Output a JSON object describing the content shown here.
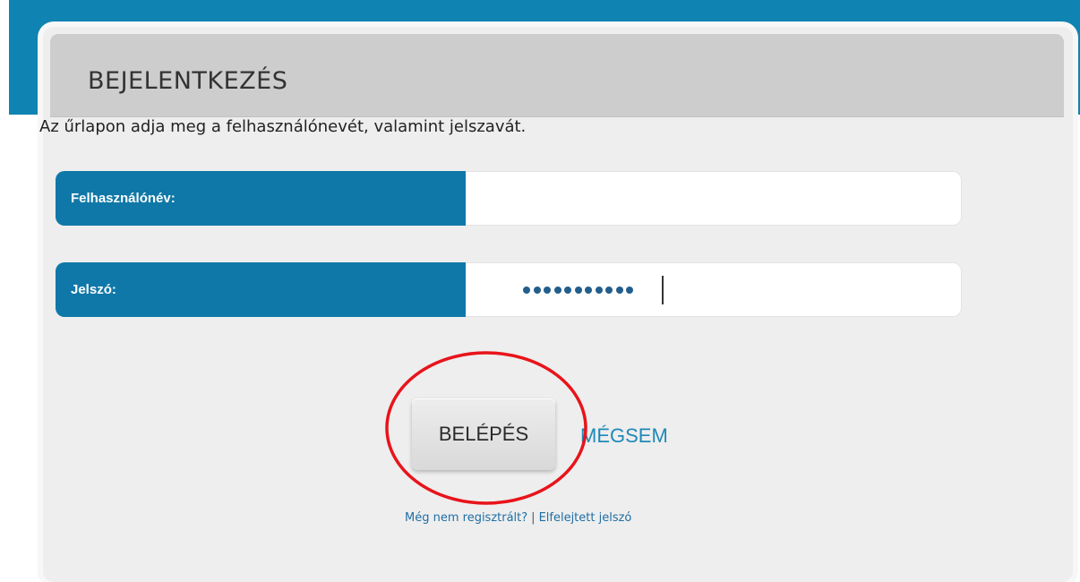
{
  "login": {
    "title": "BEJELENTKEZÉS",
    "intro": "Az űrlapon adja meg a felhasználónevét, valamint jelszavát.",
    "username": {
      "label": "Felhasználónév:",
      "value": ""
    },
    "password": {
      "label": "Jelszó:",
      "masked_length": 11
    },
    "login_button": "BELÉPÉS",
    "cancel_button": "MÉGSEM",
    "register_link": "Még nem regisztrált?",
    "separator": "|",
    "forgot_link": "Elfelejtett jelszó"
  },
  "colors": {
    "brand_blue": "#0f78a8",
    "top_band": "#0f83b2",
    "annotation_red": "#e8141a"
  }
}
